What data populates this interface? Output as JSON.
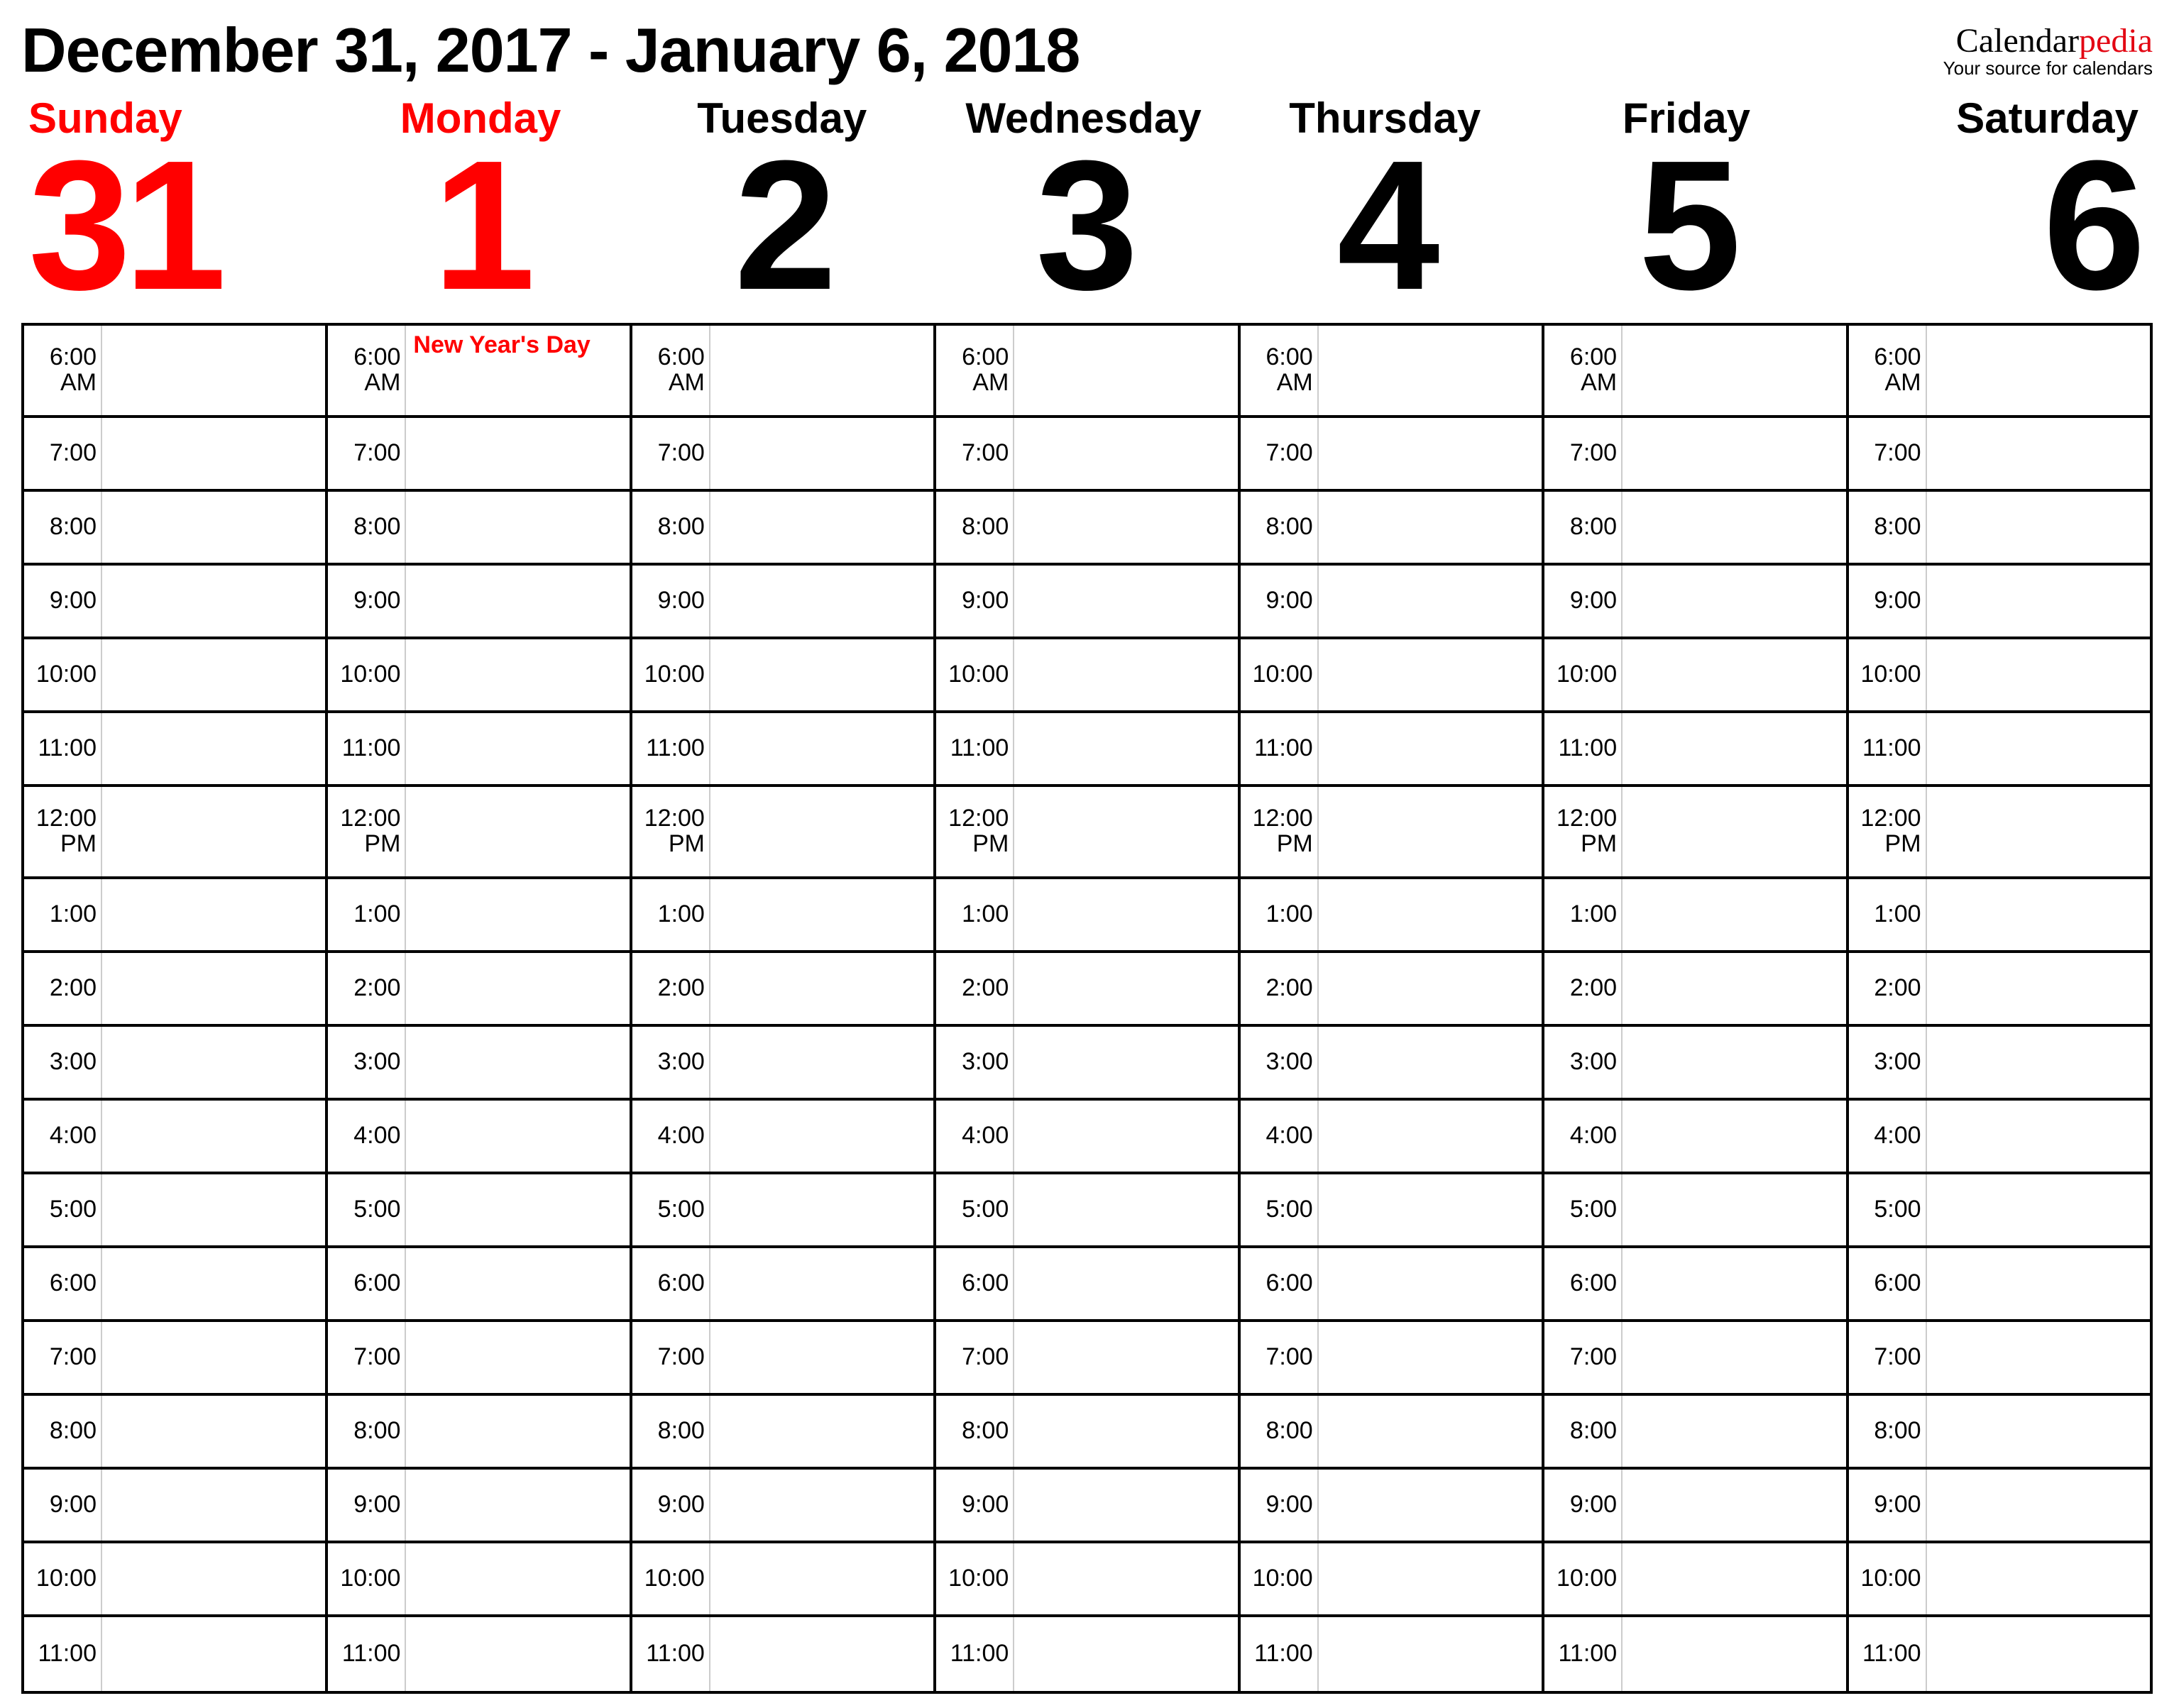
{
  "title": "December 31, 2017 - January 6, 2018",
  "brand": {
    "a": "Calendar",
    "b": "pedia",
    "tag": "Your source for calendars"
  },
  "days": [
    {
      "name": "Sunday",
      "num": "31",
      "weekend": true
    },
    {
      "name": "Monday",
      "num": "1",
      "weekend": true
    },
    {
      "name": "Tuesday",
      "num": "2",
      "weekend": false
    },
    {
      "name": "Wednesday",
      "num": "3",
      "weekend": false
    },
    {
      "name": "Thursday",
      "num": "4",
      "weekend": false
    },
    {
      "name": "Friday",
      "num": "5",
      "weekend": false
    },
    {
      "name": "Saturday",
      "num": "6",
      "weekend": false
    }
  ],
  "times": [
    {
      "t": "6:00",
      "s": "AM"
    },
    {
      "t": "7:00",
      "s": ""
    },
    {
      "t": "8:00",
      "s": ""
    },
    {
      "t": "9:00",
      "s": ""
    },
    {
      "t": "10:00",
      "s": ""
    },
    {
      "t": "11:00",
      "s": ""
    },
    {
      "t": "12:00",
      "s": "PM"
    },
    {
      "t": "1:00",
      "s": ""
    },
    {
      "t": "2:00",
      "s": ""
    },
    {
      "t": "3:00",
      "s": ""
    },
    {
      "t": "4:00",
      "s": ""
    },
    {
      "t": "5:00",
      "s": ""
    },
    {
      "t": "6:00",
      "s": ""
    },
    {
      "t": "7:00",
      "s": ""
    },
    {
      "t": "8:00",
      "s": ""
    },
    {
      "t": "9:00",
      "s": ""
    },
    {
      "t": "10:00",
      "s": ""
    },
    {
      "t": "11:00",
      "s": ""
    }
  ],
  "events": {
    "1": {
      "0": "New Year's Day"
    }
  }
}
